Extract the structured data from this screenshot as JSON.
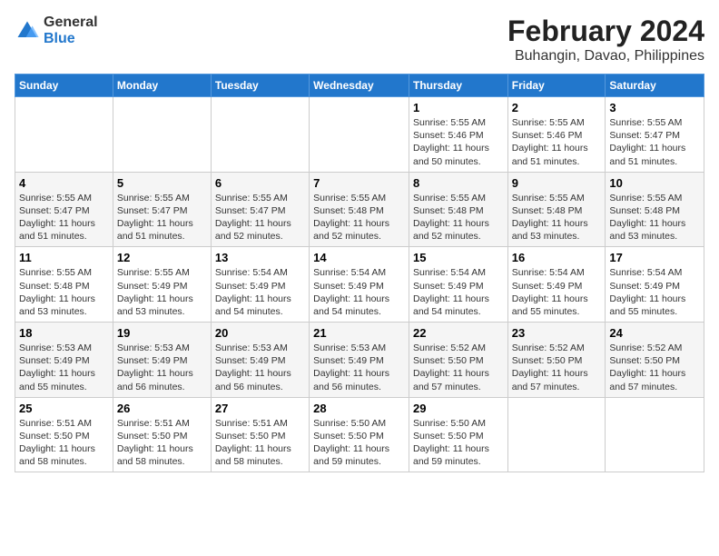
{
  "logo": {
    "line1": "General",
    "line2": "Blue"
  },
  "title": "February 2024",
  "subtitle": "Buhangin, Davao, Philippines",
  "weekdays": [
    "Sunday",
    "Monday",
    "Tuesday",
    "Wednesday",
    "Thursday",
    "Friday",
    "Saturday"
  ],
  "weeks": [
    [
      {
        "day": "",
        "info": ""
      },
      {
        "day": "",
        "info": ""
      },
      {
        "day": "",
        "info": ""
      },
      {
        "day": "",
        "info": ""
      },
      {
        "day": "1",
        "sunrise": "5:55 AM",
        "sunset": "5:46 PM",
        "daylight": "11 hours and 50 minutes."
      },
      {
        "day": "2",
        "sunrise": "5:55 AM",
        "sunset": "5:46 PM",
        "daylight": "11 hours and 51 minutes."
      },
      {
        "day": "3",
        "sunrise": "5:55 AM",
        "sunset": "5:47 PM",
        "daylight": "11 hours and 51 minutes."
      }
    ],
    [
      {
        "day": "4",
        "sunrise": "5:55 AM",
        "sunset": "5:47 PM",
        "daylight": "11 hours and 51 minutes."
      },
      {
        "day": "5",
        "sunrise": "5:55 AM",
        "sunset": "5:47 PM",
        "daylight": "11 hours and 51 minutes."
      },
      {
        "day": "6",
        "sunrise": "5:55 AM",
        "sunset": "5:47 PM",
        "daylight": "11 hours and 52 minutes."
      },
      {
        "day": "7",
        "sunrise": "5:55 AM",
        "sunset": "5:48 PM",
        "daylight": "11 hours and 52 minutes."
      },
      {
        "day": "8",
        "sunrise": "5:55 AM",
        "sunset": "5:48 PM",
        "daylight": "11 hours and 52 minutes."
      },
      {
        "day": "9",
        "sunrise": "5:55 AM",
        "sunset": "5:48 PM",
        "daylight": "11 hours and 53 minutes."
      },
      {
        "day": "10",
        "sunrise": "5:55 AM",
        "sunset": "5:48 PM",
        "daylight": "11 hours and 53 minutes."
      }
    ],
    [
      {
        "day": "11",
        "sunrise": "5:55 AM",
        "sunset": "5:48 PM",
        "daylight": "11 hours and 53 minutes."
      },
      {
        "day": "12",
        "sunrise": "5:55 AM",
        "sunset": "5:49 PM",
        "daylight": "11 hours and 53 minutes."
      },
      {
        "day": "13",
        "sunrise": "5:54 AM",
        "sunset": "5:49 PM",
        "daylight": "11 hours and 54 minutes."
      },
      {
        "day": "14",
        "sunrise": "5:54 AM",
        "sunset": "5:49 PM",
        "daylight": "11 hours and 54 minutes."
      },
      {
        "day": "15",
        "sunrise": "5:54 AM",
        "sunset": "5:49 PM",
        "daylight": "11 hours and 54 minutes."
      },
      {
        "day": "16",
        "sunrise": "5:54 AM",
        "sunset": "5:49 PM",
        "daylight": "11 hours and 55 minutes."
      },
      {
        "day": "17",
        "sunrise": "5:54 AM",
        "sunset": "5:49 PM",
        "daylight": "11 hours and 55 minutes."
      }
    ],
    [
      {
        "day": "18",
        "sunrise": "5:53 AM",
        "sunset": "5:49 PM",
        "daylight": "11 hours and 55 minutes."
      },
      {
        "day": "19",
        "sunrise": "5:53 AM",
        "sunset": "5:49 PM",
        "daylight": "11 hours and 56 minutes."
      },
      {
        "day": "20",
        "sunrise": "5:53 AM",
        "sunset": "5:49 PM",
        "daylight": "11 hours and 56 minutes."
      },
      {
        "day": "21",
        "sunrise": "5:53 AM",
        "sunset": "5:49 PM",
        "daylight": "11 hours and 56 minutes."
      },
      {
        "day": "22",
        "sunrise": "5:52 AM",
        "sunset": "5:50 PM",
        "daylight": "11 hours and 57 minutes."
      },
      {
        "day": "23",
        "sunrise": "5:52 AM",
        "sunset": "5:50 PM",
        "daylight": "11 hours and 57 minutes."
      },
      {
        "day": "24",
        "sunrise": "5:52 AM",
        "sunset": "5:50 PM",
        "daylight": "11 hours and 57 minutes."
      }
    ],
    [
      {
        "day": "25",
        "sunrise": "5:51 AM",
        "sunset": "5:50 PM",
        "daylight": "11 hours and 58 minutes."
      },
      {
        "day": "26",
        "sunrise": "5:51 AM",
        "sunset": "5:50 PM",
        "daylight": "11 hours and 58 minutes."
      },
      {
        "day": "27",
        "sunrise": "5:51 AM",
        "sunset": "5:50 PM",
        "daylight": "11 hours and 58 minutes."
      },
      {
        "day": "28",
        "sunrise": "5:50 AM",
        "sunset": "5:50 PM",
        "daylight": "11 hours and 59 minutes."
      },
      {
        "day": "29",
        "sunrise": "5:50 AM",
        "sunset": "5:50 PM",
        "daylight": "11 hours and 59 minutes."
      },
      {
        "day": "",
        "info": ""
      },
      {
        "day": "",
        "info": ""
      }
    ]
  ]
}
